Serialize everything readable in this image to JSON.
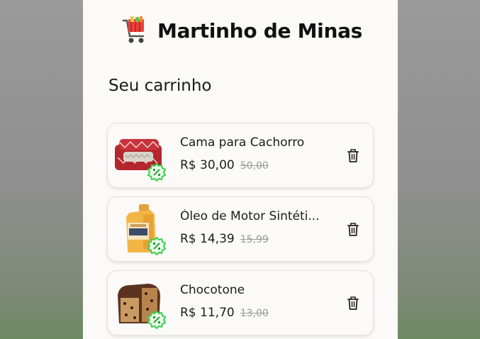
{
  "app": {
    "title": "Martinho de Minas"
  },
  "cart": {
    "heading": "Seu carrinho",
    "items": [
      {
        "name": "Cama para Cachorro",
        "price": "R$ 30,00",
        "old_price": "50,00",
        "thumb_icon": "dog-bed",
        "has_discount": true
      },
      {
        "name": "Óleo de Motor Sintéti...",
        "price": "R$ 14,39",
        "old_price": "15,99",
        "thumb_icon": "motor-oil-bottle",
        "has_discount": true
      },
      {
        "name": "Chocotone",
        "price": "R$ 11,70",
        "old_price": "13,00",
        "thumb_icon": "chocotone-cake",
        "has_discount": true
      }
    ]
  },
  "colors": {
    "discount_green": "#3ccf4e",
    "badge_bg": "#e9fbe9",
    "background": "#fbfaf8"
  }
}
